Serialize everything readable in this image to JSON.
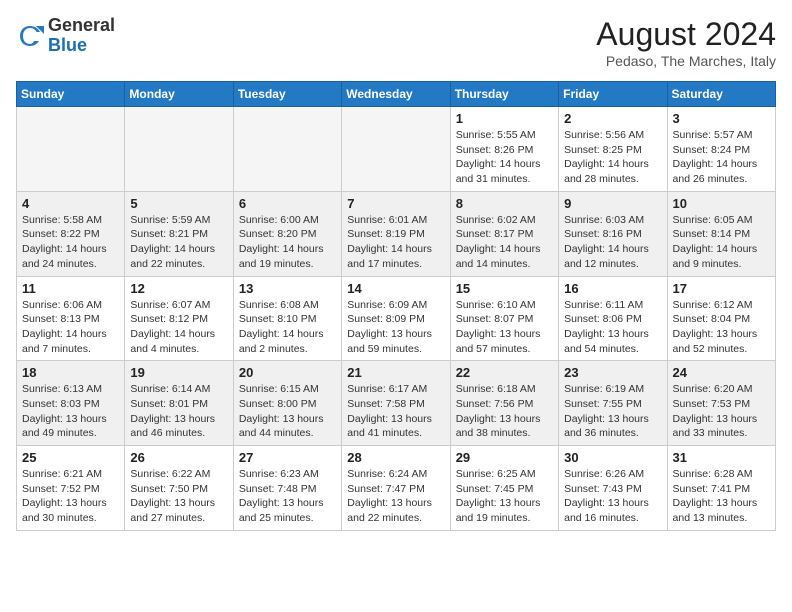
{
  "header": {
    "logo_general": "General",
    "logo_blue": "Blue",
    "month_year": "August 2024",
    "location": "Pedaso, The Marches, Italy"
  },
  "weekdays": [
    "Sunday",
    "Monday",
    "Tuesday",
    "Wednesday",
    "Thursday",
    "Friday",
    "Saturday"
  ],
  "weeks": [
    [
      {
        "day": "",
        "info": "",
        "empty": true
      },
      {
        "day": "",
        "info": "",
        "empty": true
      },
      {
        "day": "",
        "info": "",
        "empty": true
      },
      {
        "day": "",
        "info": "",
        "empty": true
      },
      {
        "day": "1",
        "info": "Sunrise: 5:55 AM\nSunset: 8:26 PM\nDaylight: 14 hours\nand 31 minutes."
      },
      {
        "day": "2",
        "info": "Sunrise: 5:56 AM\nSunset: 8:25 PM\nDaylight: 14 hours\nand 28 minutes."
      },
      {
        "day": "3",
        "info": "Sunrise: 5:57 AM\nSunset: 8:24 PM\nDaylight: 14 hours\nand 26 minutes."
      }
    ],
    [
      {
        "day": "4",
        "info": "Sunrise: 5:58 AM\nSunset: 8:22 PM\nDaylight: 14 hours\nand 24 minutes."
      },
      {
        "day": "5",
        "info": "Sunrise: 5:59 AM\nSunset: 8:21 PM\nDaylight: 14 hours\nand 22 minutes."
      },
      {
        "day": "6",
        "info": "Sunrise: 6:00 AM\nSunset: 8:20 PM\nDaylight: 14 hours\nand 19 minutes."
      },
      {
        "day": "7",
        "info": "Sunrise: 6:01 AM\nSunset: 8:19 PM\nDaylight: 14 hours\nand 17 minutes."
      },
      {
        "day": "8",
        "info": "Sunrise: 6:02 AM\nSunset: 8:17 PM\nDaylight: 14 hours\nand 14 minutes."
      },
      {
        "day": "9",
        "info": "Sunrise: 6:03 AM\nSunset: 8:16 PM\nDaylight: 14 hours\nand 12 minutes."
      },
      {
        "day": "10",
        "info": "Sunrise: 6:05 AM\nSunset: 8:14 PM\nDaylight: 14 hours\nand 9 minutes."
      }
    ],
    [
      {
        "day": "11",
        "info": "Sunrise: 6:06 AM\nSunset: 8:13 PM\nDaylight: 14 hours\nand 7 minutes."
      },
      {
        "day": "12",
        "info": "Sunrise: 6:07 AM\nSunset: 8:12 PM\nDaylight: 14 hours\nand 4 minutes."
      },
      {
        "day": "13",
        "info": "Sunrise: 6:08 AM\nSunset: 8:10 PM\nDaylight: 14 hours\nand 2 minutes."
      },
      {
        "day": "14",
        "info": "Sunrise: 6:09 AM\nSunset: 8:09 PM\nDaylight: 13 hours\nand 59 minutes."
      },
      {
        "day": "15",
        "info": "Sunrise: 6:10 AM\nSunset: 8:07 PM\nDaylight: 13 hours\nand 57 minutes."
      },
      {
        "day": "16",
        "info": "Sunrise: 6:11 AM\nSunset: 8:06 PM\nDaylight: 13 hours\nand 54 minutes."
      },
      {
        "day": "17",
        "info": "Sunrise: 6:12 AM\nSunset: 8:04 PM\nDaylight: 13 hours\nand 52 minutes."
      }
    ],
    [
      {
        "day": "18",
        "info": "Sunrise: 6:13 AM\nSunset: 8:03 PM\nDaylight: 13 hours\nand 49 minutes."
      },
      {
        "day": "19",
        "info": "Sunrise: 6:14 AM\nSunset: 8:01 PM\nDaylight: 13 hours\nand 46 minutes."
      },
      {
        "day": "20",
        "info": "Sunrise: 6:15 AM\nSunset: 8:00 PM\nDaylight: 13 hours\nand 44 minutes."
      },
      {
        "day": "21",
        "info": "Sunrise: 6:17 AM\nSunset: 7:58 PM\nDaylight: 13 hours\nand 41 minutes."
      },
      {
        "day": "22",
        "info": "Sunrise: 6:18 AM\nSunset: 7:56 PM\nDaylight: 13 hours\nand 38 minutes."
      },
      {
        "day": "23",
        "info": "Sunrise: 6:19 AM\nSunset: 7:55 PM\nDaylight: 13 hours\nand 36 minutes."
      },
      {
        "day": "24",
        "info": "Sunrise: 6:20 AM\nSunset: 7:53 PM\nDaylight: 13 hours\nand 33 minutes."
      }
    ],
    [
      {
        "day": "25",
        "info": "Sunrise: 6:21 AM\nSunset: 7:52 PM\nDaylight: 13 hours\nand 30 minutes."
      },
      {
        "day": "26",
        "info": "Sunrise: 6:22 AM\nSunset: 7:50 PM\nDaylight: 13 hours\nand 27 minutes."
      },
      {
        "day": "27",
        "info": "Sunrise: 6:23 AM\nSunset: 7:48 PM\nDaylight: 13 hours\nand 25 minutes."
      },
      {
        "day": "28",
        "info": "Sunrise: 6:24 AM\nSunset: 7:47 PM\nDaylight: 13 hours\nand 22 minutes."
      },
      {
        "day": "29",
        "info": "Sunrise: 6:25 AM\nSunset: 7:45 PM\nDaylight: 13 hours\nand 19 minutes."
      },
      {
        "day": "30",
        "info": "Sunrise: 6:26 AM\nSunset: 7:43 PM\nDaylight: 13 hours\nand 16 minutes."
      },
      {
        "day": "31",
        "info": "Sunrise: 6:28 AM\nSunset: 7:41 PM\nDaylight: 13 hours\nand 13 minutes."
      }
    ]
  ]
}
